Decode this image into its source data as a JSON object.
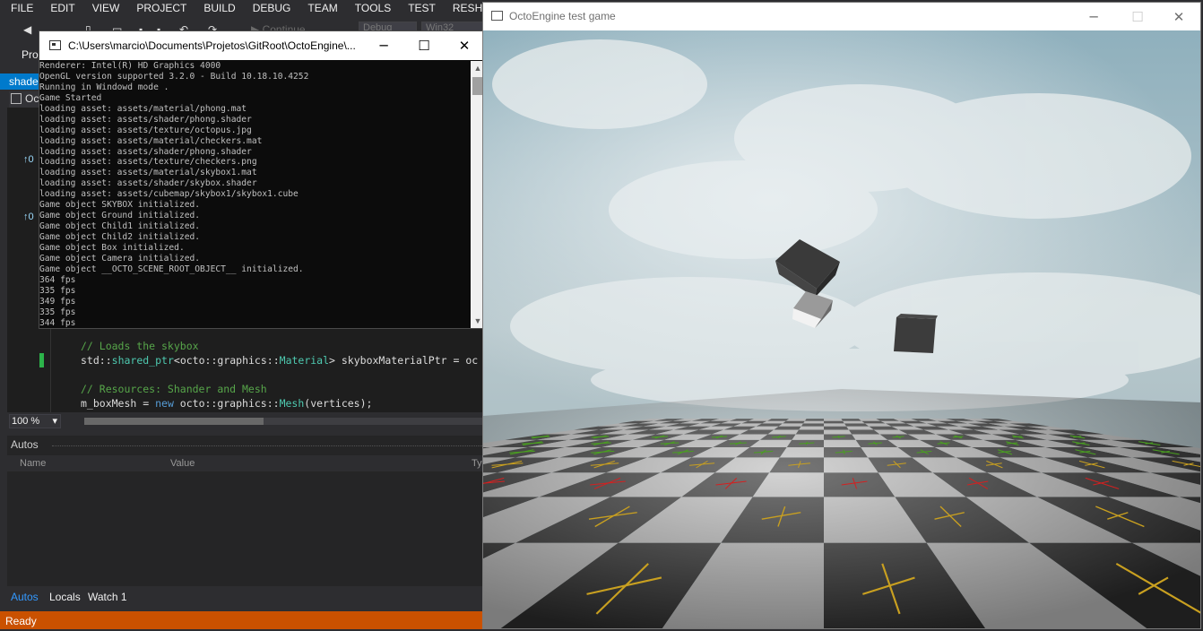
{
  "vs": {
    "menu": [
      "FILE",
      "EDIT",
      "VIEW",
      "PROJECT",
      "BUILD",
      "DEBUG",
      "TEAM",
      "TOOLS",
      "TEST",
      "RESHARPER"
    ],
    "toolbar": {
      "continue_label": "Continue",
      "config_dropdown": "Debug",
      "platform_dropdown": "Win32"
    },
    "project_label": "Pro",
    "doc_tab": "shade",
    "nav_item": "Oc",
    "ref_marker": "0",
    "code_lines": [
      {
        "kind": "comment",
        "text": "// Loads the skybox"
      },
      {
        "kind": "code1",
        "parts": [
          "std",
          "::",
          "shared_ptr",
          "<",
          "octo",
          "::",
          "graphics",
          "::",
          "Material",
          "> skyboxMaterialPtr = oc"
        ]
      },
      {
        "kind": "comment",
        "text": "// Resources: Shander and Mesh"
      },
      {
        "kind": "code2",
        "parts": [
          "m_boxMesh = ",
          "new",
          " octo::graphics::",
          "Mesh",
          "(vertices);"
        ]
      }
    ],
    "zoom": "100 %",
    "autos": {
      "title": "Autos",
      "columns": [
        "Name",
        "Value",
        "Ty"
      ],
      "tabs": [
        "Autos",
        "Locals",
        "Watch 1"
      ]
    },
    "status": "Ready"
  },
  "console": {
    "title": "C:\\Users\\marcio\\Documents\\Projetos\\GitRoot\\OctoEngine\\...",
    "minimize": "─",
    "maximize": "☐",
    "close": "✕",
    "lines": [
      "Renderer: Intel(R) HD Graphics 4000",
      "OpenGL version supported 3.2.0 - Build 10.18.10.4252",
      "Running in Windowd mode .",
      "Game Started",
      "loading asset: assets/material/phong.mat",
      "loading asset: assets/shader/phong.shader",
      "loading asset: assets/texture/octopus.jpg",
      "loading asset: assets/material/checkers.mat",
      "loading asset: assets/shader/phong.shader",
      "loading asset: assets/texture/checkers.png",
      "loading asset: assets/material/skybox1.mat",
      "loading asset: assets/shader/skybox.shader",
      "loading asset: assets/cubemap/skybox1/skybox1.cube",
      "Game object SKYBOX initialized.",
      "Game object Ground initialized.",
      "Game object Child1 initialized.",
      "Game object Child2 initialized.",
      "Game object Box initialized.",
      "Game object Camera initialized.",
      "Game object __OCTO_SCENE_ROOT_OBJECT__ initialized.",
      "364 fps",
      "335 fps",
      "349 fps",
      "335 fps",
      "344 fps"
    ]
  },
  "game": {
    "title": "OctoEngine test game",
    "minimize": "─",
    "maximize": "☐",
    "close": "✕"
  },
  "colors": {
    "vs_bg": "#2d2d30",
    "accent": "#007acc",
    "status_bar": "#ca5100",
    "cross_red": "#d42020",
    "cross_yellow": "#c9a020",
    "cross_green": "#4aa020"
  }
}
